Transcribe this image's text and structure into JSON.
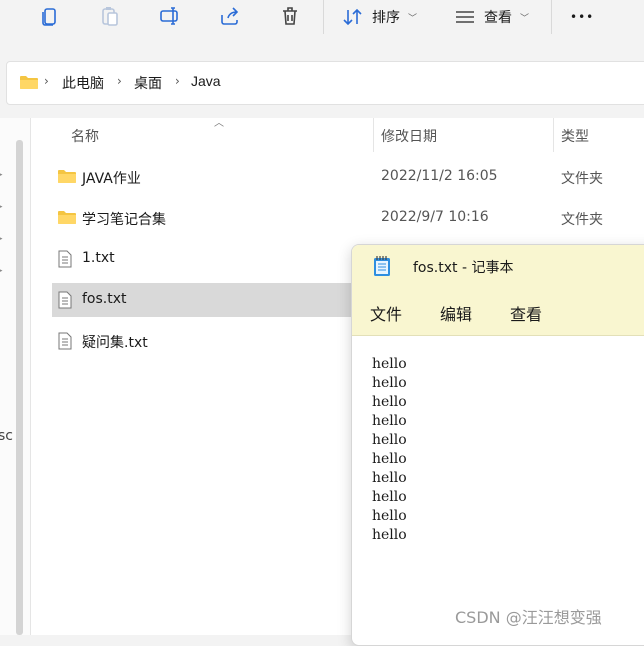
{
  "toolbar": {
    "sort_label": "排序",
    "view_label": "查看",
    "more_label": "•••",
    "icons": [
      "copy-icon",
      "paste-icon",
      "rename-icon",
      "share-icon",
      "delete-icon",
      "sort-icon",
      "view-icon",
      "more-icon"
    ]
  },
  "address": {
    "crumbs": [
      "此电脑",
      "桌面",
      "Java"
    ]
  },
  "columns": {
    "name": "名称",
    "modified": "修改日期",
    "type": "类型"
  },
  "files": [
    {
      "name": "JAVA作业",
      "date": "2022/11/2 16:05",
      "type": "文件夹",
      "kind": "folder"
    },
    {
      "name": "学习笔记合集",
      "date": "2022/9/7 10:16",
      "type": "文件夹",
      "kind": "folder"
    },
    {
      "name": "1.txt",
      "date": "",
      "type": "",
      "kind": "txt"
    },
    {
      "name": "fos.txt",
      "date": "",
      "type": "",
      "kind": "txt",
      "selected": true
    },
    {
      "name": "疑问集.txt",
      "date": "",
      "type": "",
      "kind": "txt"
    }
  ],
  "notepad": {
    "title": "fos.txt - 记事本",
    "menu": [
      "文件",
      "编辑",
      "查看"
    ],
    "lines": [
      "hello",
      "hello",
      "hello",
      "hello",
      "hello",
      "hello",
      "hello",
      "hello",
      "hello",
      "hello"
    ]
  },
  "nav_pane": {
    "cut_text": "sc"
  },
  "watermark": "CSDN @汪汪想变强",
  "colors": {
    "folder": "#f4c542",
    "selected_row": "#d9d9d9",
    "notepad_bar": "#f9f6d0"
  }
}
